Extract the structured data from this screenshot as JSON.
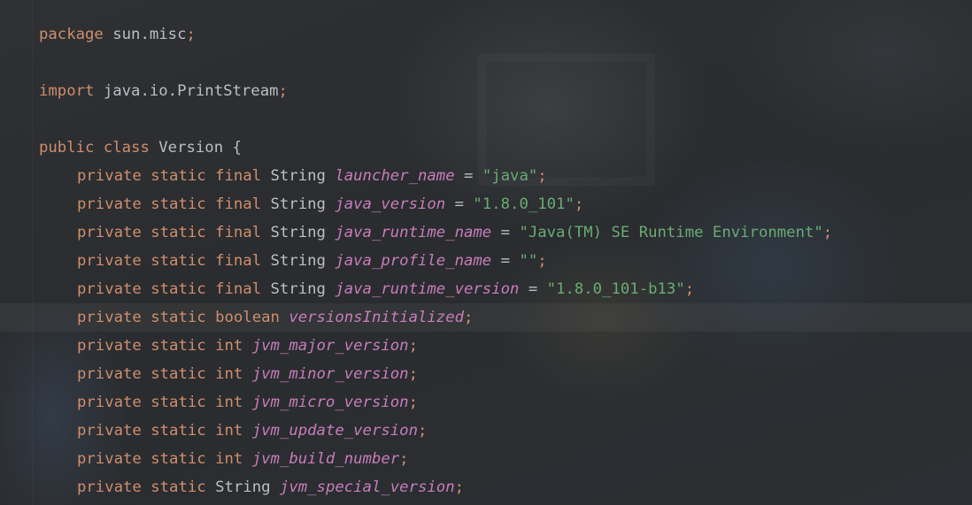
{
  "editor": {
    "language": "Java",
    "current_line_index": 10,
    "lines": [
      {
        "type": "package",
        "keyword": "package",
        "name": "sun.misc",
        "semicolon": ";"
      },
      {
        "type": "blank"
      },
      {
        "type": "import",
        "keyword": "import",
        "name": "java.io.PrintStream",
        "semicolon": ";"
      },
      {
        "type": "blank"
      },
      {
        "type": "class",
        "modifier": "public",
        "keyword": "class",
        "name": "Version",
        "brace": "{"
      },
      {
        "type": "field",
        "modifiers": "private static final",
        "field_type": "String",
        "name": "launcher_name",
        "eq": "=",
        "value": "\"java\"",
        "semicolon": ";"
      },
      {
        "type": "field",
        "modifiers": "private static final",
        "field_type": "String",
        "name": "java_version",
        "eq": "=",
        "value": "\"1.8.0_101\"",
        "semicolon": ";"
      },
      {
        "type": "field",
        "modifiers": "private static final",
        "field_type": "String",
        "name": "java_runtime_name",
        "eq": "=",
        "value": "\"Java(TM) SE Runtime Environment\"",
        "semicolon": ";"
      },
      {
        "type": "field",
        "modifiers": "private static final",
        "field_type": "String",
        "name": "java_profile_name",
        "eq": "=",
        "value": "\"\"",
        "semicolon": ";"
      },
      {
        "type": "field",
        "modifiers": "private static final",
        "field_type": "String",
        "name": "java_runtime_version",
        "eq": "=",
        "value": "\"1.8.0_101-b13\"",
        "semicolon": ";"
      },
      {
        "type": "decl",
        "modifiers": "private static",
        "field_type": "boolean",
        "name": "versionsInitialized",
        "semicolon": ";"
      },
      {
        "type": "decl",
        "modifiers": "private static",
        "field_type": "int",
        "name": "jvm_major_version",
        "semicolon": ";"
      },
      {
        "type": "decl",
        "modifiers": "private static",
        "field_type": "int",
        "name": "jvm_minor_version",
        "semicolon": ";"
      },
      {
        "type": "decl",
        "modifiers": "private static",
        "field_type": "int",
        "name": "jvm_micro_version",
        "semicolon": ";"
      },
      {
        "type": "decl",
        "modifiers": "private static",
        "field_type": "int",
        "name": "jvm_update_version",
        "semicolon": ";"
      },
      {
        "type": "decl",
        "modifiers": "private static",
        "field_type": "int",
        "name": "jvm_build_number",
        "semicolon": ";"
      },
      {
        "type": "decl",
        "modifiers": "private static",
        "field_type": "String",
        "name": "jvm_special_version",
        "semicolon": ";"
      }
    ]
  },
  "colors": {
    "background": "#2b2d30",
    "keyword": "#cf8e6d",
    "identifier": "#bcbec4",
    "field": "#c77dbb",
    "string": "#6aab73",
    "current_line": "#34363a"
  }
}
